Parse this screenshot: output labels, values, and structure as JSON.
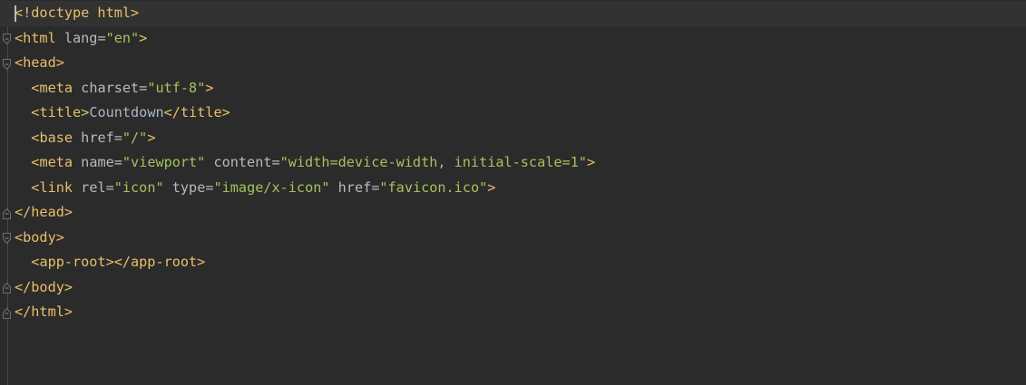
{
  "editor": {
    "language": "HTML",
    "colors": {
      "background": "#2b2b2b",
      "current_line": "#323232",
      "tag": "#e8bf6a",
      "attribute": "#bababa",
      "string": "#a5c25c",
      "text": "#a9b7c6"
    },
    "lines": [
      {
        "fold": "none",
        "tokens": [
          [
            "tag",
            "<!doctype html>"
          ]
        ]
      },
      {
        "fold": "open",
        "tokens": [
          [
            "tag",
            "<html "
          ],
          [
            "attr",
            "lang="
          ],
          [
            "val",
            "\"en\""
          ],
          [
            "tag",
            ">"
          ]
        ]
      },
      {
        "fold": "open",
        "tokens": [
          [
            "tag",
            "<head>"
          ]
        ]
      },
      {
        "fold": "none",
        "tokens": [
          [
            "text",
            "  "
          ],
          [
            "tag",
            "<meta "
          ],
          [
            "attr",
            "charset="
          ],
          [
            "val",
            "\"utf-8\""
          ],
          [
            "tag",
            ">"
          ]
        ]
      },
      {
        "fold": "none",
        "tokens": [
          [
            "text",
            "  "
          ],
          [
            "tag",
            "<title>"
          ],
          [
            "text",
            "Countdown"
          ],
          [
            "tag",
            "</title>"
          ]
        ]
      },
      {
        "fold": "none",
        "tokens": [
          [
            "text",
            "  "
          ],
          [
            "tag",
            "<base "
          ],
          [
            "attr",
            "href="
          ],
          [
            "val",
            "\"/\""
          ],
          [
            "tag",
            ">"
          ]
        ]
      },
      {
        "fold": "none",
        "tokens": [
          [
            "text",
            "  "
          ],
          [
            "tag",
            "<meta "
          ],
          [
            "attr",
            "name="
          ],
          [
            "val",
            "\"viewport\""
          ],
          [
            "attr",
            " content="
          ],
          [
            "val",
            "\"width=device-width, initial-scale=1\""
          ],
          [
            "tag",
            ">"
          ]
        ]
      },
      {
        "fold": "none",
        "tokens": [
          [
            "text",
            "  "
          ],
          [
            "tag",
            "<link "
          ],
          [
            "attr",
            "rel="
          ],
          [
            "val",
            "\"icon\""
          ],
          [
            "attr",
            " type="
          ],
          [
            "val",
            "\"image/x-icon\""
          ],
          [
            "attr",
            " href="
          ],
          [
            "val",
            "\"favicon.ico\""
          ],
          [
            "tag",
            ">"
          ]
        ]
      },
      {
        "fold": "close",
        "tokens": [
          [
            "tag",
            "</head>"
          ]
        ]
      },
      {
        "fold": "open",
        "tokens": [
          [
            "tag",
            "<body>"
          ]
        ]
      },
      {
        "fold": "none",
        "tokens": [
          [
            "text",
            "  "
          ],
          [
            "tag",
            "<app-root></app-root>"
          ]
        ]
      },
      {
        "fold": "close",
        "tokens": [
          [
            "tag",
            "</body>"
          ]
        ]
      },
      {
        "fold": "close",
        "tokens": [
          [
            "tag",
            "</html>"
          ]
        ]
      }
    ]
  }
}
